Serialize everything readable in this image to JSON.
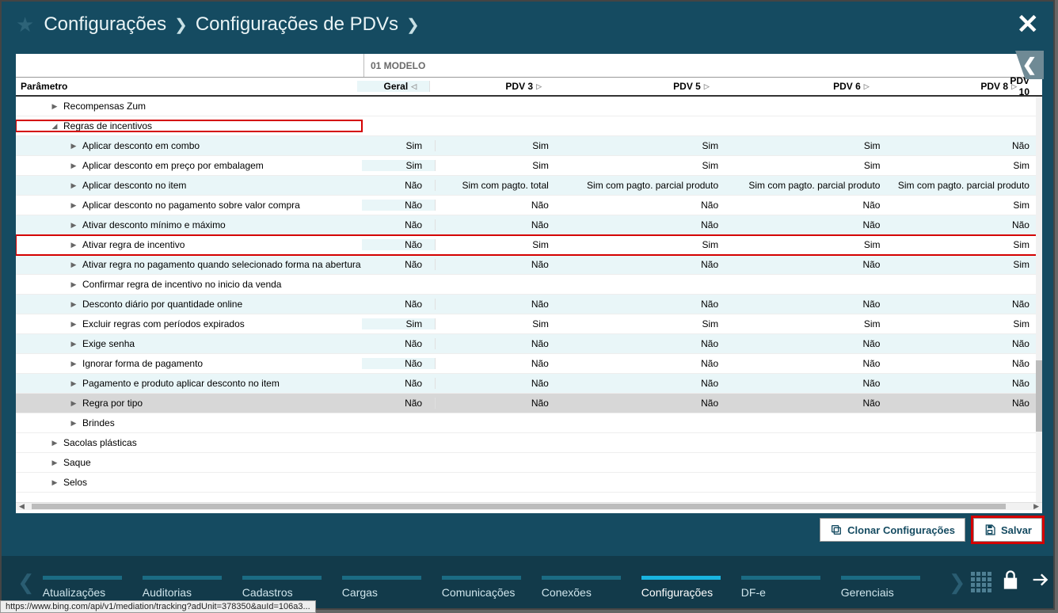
{
  "breadcrumb": {
    "item1": "Configurações",
    "item2": "Configurações de PDVs"
  },
  "model_header": "01 MODELO",
  "columns": {
    "param": "Parâmetro",
    "geral": "Geral",
    "pdv3": "PDV 3",
    "pdv5": "PDV 5",
    "pdv6": "PDV 6",
    "pdv8": "PDV 8",
    "pdv10": "PDV 10"
  },
  "rows": [
    {
      "indent": 1,
      "disclosure": "▶",
      "label": "Recompensas Zum",
      "vals": [
        "",
        "",
        "",
        "",
        "",
        ""
      ]
    },
    {
      "indent": 1,
      "disclosure": "◢",
      "label": "Regras de incentivos",
      "highlightGroup": true,
      "vals": [
        "",
        "",
        "",
        "",
        "",
        ""
      ]
    },
    {
      "indent": 2,
      "disclosure": "▶",
      "label": "Aplicar desconto em combo",
      "shaded": true,
      "vals": [
        "Sim",
        "Sim",
        "Sim",
        "Sim",
        "Não"
      ]
    },
    {
      "indent": 2,
      "disclosure": "▶",
      "label": "Aplicar desconto em preço por embalagem",
      "vals": [
        "Sim",
        "Sim",
        "Sim",
        "Sim",
        "Sim"
      ]
    },
    {
      "indent": 2,
      "disclosure": "▶",
      "label": "Aplicar desconto no item",
      "shaded": true,
      "vals": [
        "Não",
        "Sim com pagto. total",
        "Sim com pagto. parcial produto",
        "Sim com pagto. parcial produto",
        "Sim com pagto. parcial produto"
      ]
    },
    {
      "indent": 2,
      "disclosure": "▶",
      "label": "Aplicar desconto no pagamento sobre valor compra",
      "vals": [
        "Não",
        "Não",
        "Não",
        "Não",
        "Sim"
      ]
    },
    {
      "indent": 2,
      "disclosure": "▶",
      "label": "Ativar desconto mínimo e máximo",
      "shaded": true,
      "vals": [
        "Não",
        "Não",
        "Não",
        "Não",
        "Não"
      ]
    },
    {
      "indent": 2,
      "disclosure": "▶",
      "label": "Ativar regra de incentivo",
      "highlightRow": true,
      "vals": [
        "Não",
        "Sim",
        "Sim",
        "Sim",
        "Sim"
      ]
    },
    {
      "indent": 2,
      "disclosure": "▶",
      "label": "Ativar regra no pagamento quando selecionado forma na abertura",
      "shaded": true,
      "vals": [
        "Não",
        "Não",
        "Não",
        "Não",
        "Sim"
      ]
    },
    {
      "indent": 2,
      "disclosure": "▶",
      "label": "Confirmar regra de incentivo no inicio da venda",
      "vals": [
        "",
        "",
        "",
        "",
        "",
        ""
      ]
    },
    {
      "indent": 2,
      "disclosure": "▶",
      "label": "Desconto diário por quantidade online",
      "shaded": true,
      "vals": [
        "Não",
        "Não",
        "Não",
        "Não",
        "Não"
      ]
    },
    {
      "indent": 2,
      "disclosure": "▶",
      "label": "Excluir regras com períodos expirados",
      "vals": [
        "Sim",
        "Sim",
        "Sim",
        "Sim",
        "Sim"
      ]
    },
    {
      "indent": 2,
      "disclosure": "▶",
      "label": "Exige senha",
      "shaded": true,
      "vals": [
        "Não",
        "Não",
        "Não",
        "Não",
        "Não"
      ]
    },
    {
      "indent": 2,
      "disclosure": "▶",
      "label": "Ignorar forma de pagamento",
      "vals": [
        "Não",
        "Não",
        "Não",
        "Não",
        "Não"
      ]
    },
    {
      "indent": 2,
      "disclosure": "▶",
      "label": "Pagamento e produto aplicar desconto no item",
      "shaded": true,
      "vals": [
        "Não",
        "Não",
        "Não",
        "Não",
        "Não"
      ]
    },
    {
      "indent": 2,
      "disclosure": "▶",
      "label": "Regra por tipo",
      "grey": true,
      "vals": [
        "Não",
        "Não",
        "Não",
        "Não",
        "Não"
      ]
    },
    {
      "indent": 2,
      "disclosure": "▶",
      "label": "Brindes",
      "vals": [
        "",
        "",
        "",
        "",
        "",
        ""
      ]
    },
    {
      "indent": 1,
      "disclosure": "▶",
      "label": "Sacolas plásticas",
      "vals": [
        "",
        "",
        "",
        "",
        "",
        ""
      ]
    },
    {
      "indent": 1,
      "disclosure": "▶",
      "label": "Saque",
      "vals": [
        "",
        "",
        "",
        "",
        "",
        ""
      ]
    },
    {
      "indent": 1,
      "disclosure": "▶",
      "label": "Selos",
      "vals": [
        "",
        "",
        "",
        "",
        "",
        ""
      ]
    }
  ],
  "buttons": {
    "clone": "Clonar Configurações",
    "save": "Salvar"
  },
  "bottom_tabs": [
    {
      "label": "Atualizações",
      "active": false
    },
    {
      "label": "Auditorias",
      "active": false
    },
    {
      "label": "Cadastros",
      "active": false
    },
    {
      "label": "Cargas",
      "active": false
    },
    {
      "label": "Comunicações",
      "active": false
    },
    {
      "label": "Conexões",
      "active": false
    },
    {
      "label": "Configurações",
      "active": true
    },
    {
      "label": "DF-e",
      "active": false
    },
    {
      "label": "Gerenciais",
      "active": false
    }
  ],
  "status_url": "https://www.bing.com/api/v1/mediation/tracking?adUnit=378350&auId=106a3..."
}
